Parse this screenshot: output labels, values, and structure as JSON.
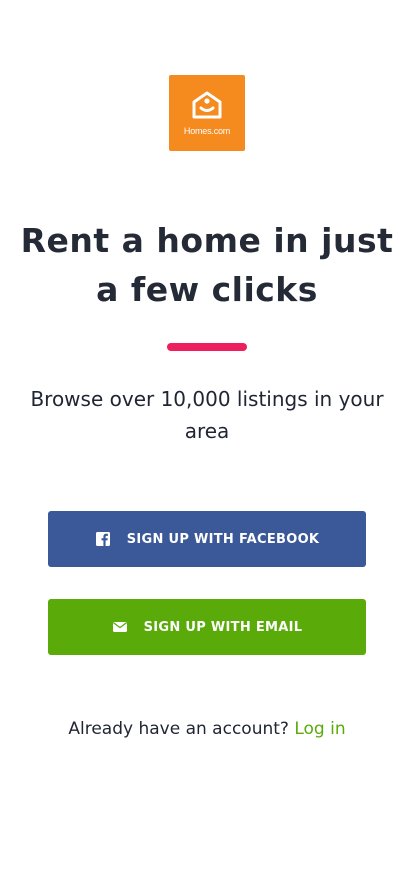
{
  "logo": {
    "icon": "house-icon",
    "text": "Homes.com",
    "color": "#f58a1f"
  },
  "hero": {
    "headline": "Rent a home in just a few clicks",
    "divider_color": "#ee1f5c",
    "subtitle": "Browse over 10,000 listings in your area"
  },
  "buttons": {
    "facebook": {
      "label": "SIGN UP WITH FACEBOOK",
      "icon": "facebook-icon",
      "color": "#3b5998"
    },
    "email": {
      "label": "SIGN UP WITH EMAIL",
      "icon": "envelope-icon",
      "color": "#5aab0a"
    }
  },
  "login": {
    "prompt": "Already have an account?",
    "link_label": "Log in",
    "link_color": "#5aab0a"
  }
}
